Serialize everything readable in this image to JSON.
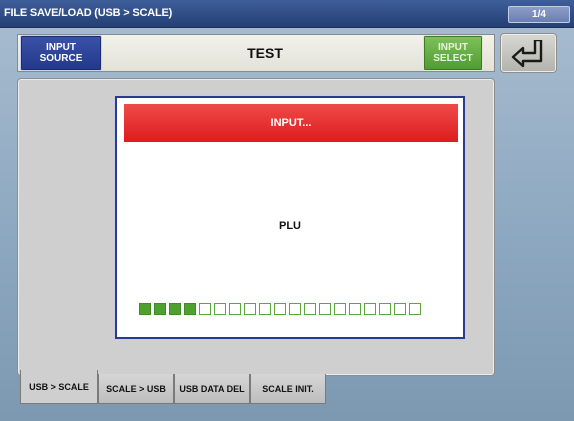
{
  "window": {
    "title": "FILE SAVE/LOAD (USB > SCALE)",
    "page_indicator": "1/4"
  },
  "header": {
    "input_source_line1": "INPUT",
    "input_source_line2": "SOURCE",
    "title": "TEST",
    "input_select_line1": "INPUT",
    "input_select_line2": "SELECT",
    "back_icon": "return-arrow-icon"
  },
  "dialog": {
    "header": "INPUT...",
    "message": "PLU",
    "progress": {
      "filled": 4,
      "total": 19
    }
  },
  "tabs": [
    {
      "label": "USB > SCALE",
      "active": true
    },
    {
      "label": "SCALE > USB",
      "active": false
    },
    {
      "label": "USB DATA DEL",
      "active": false
    },
    {
      "label": "SCALE INIT.",
      "active": false
    }
  ],
  "colors": {
    "titlebar": "#2f4d86",
    "input_source_button": "#2e469c",
    "input_select_button": "#5fa83f",
    "dialog_header": "#e42a2b",
    "progress": "#4fa12f"
  }
}
